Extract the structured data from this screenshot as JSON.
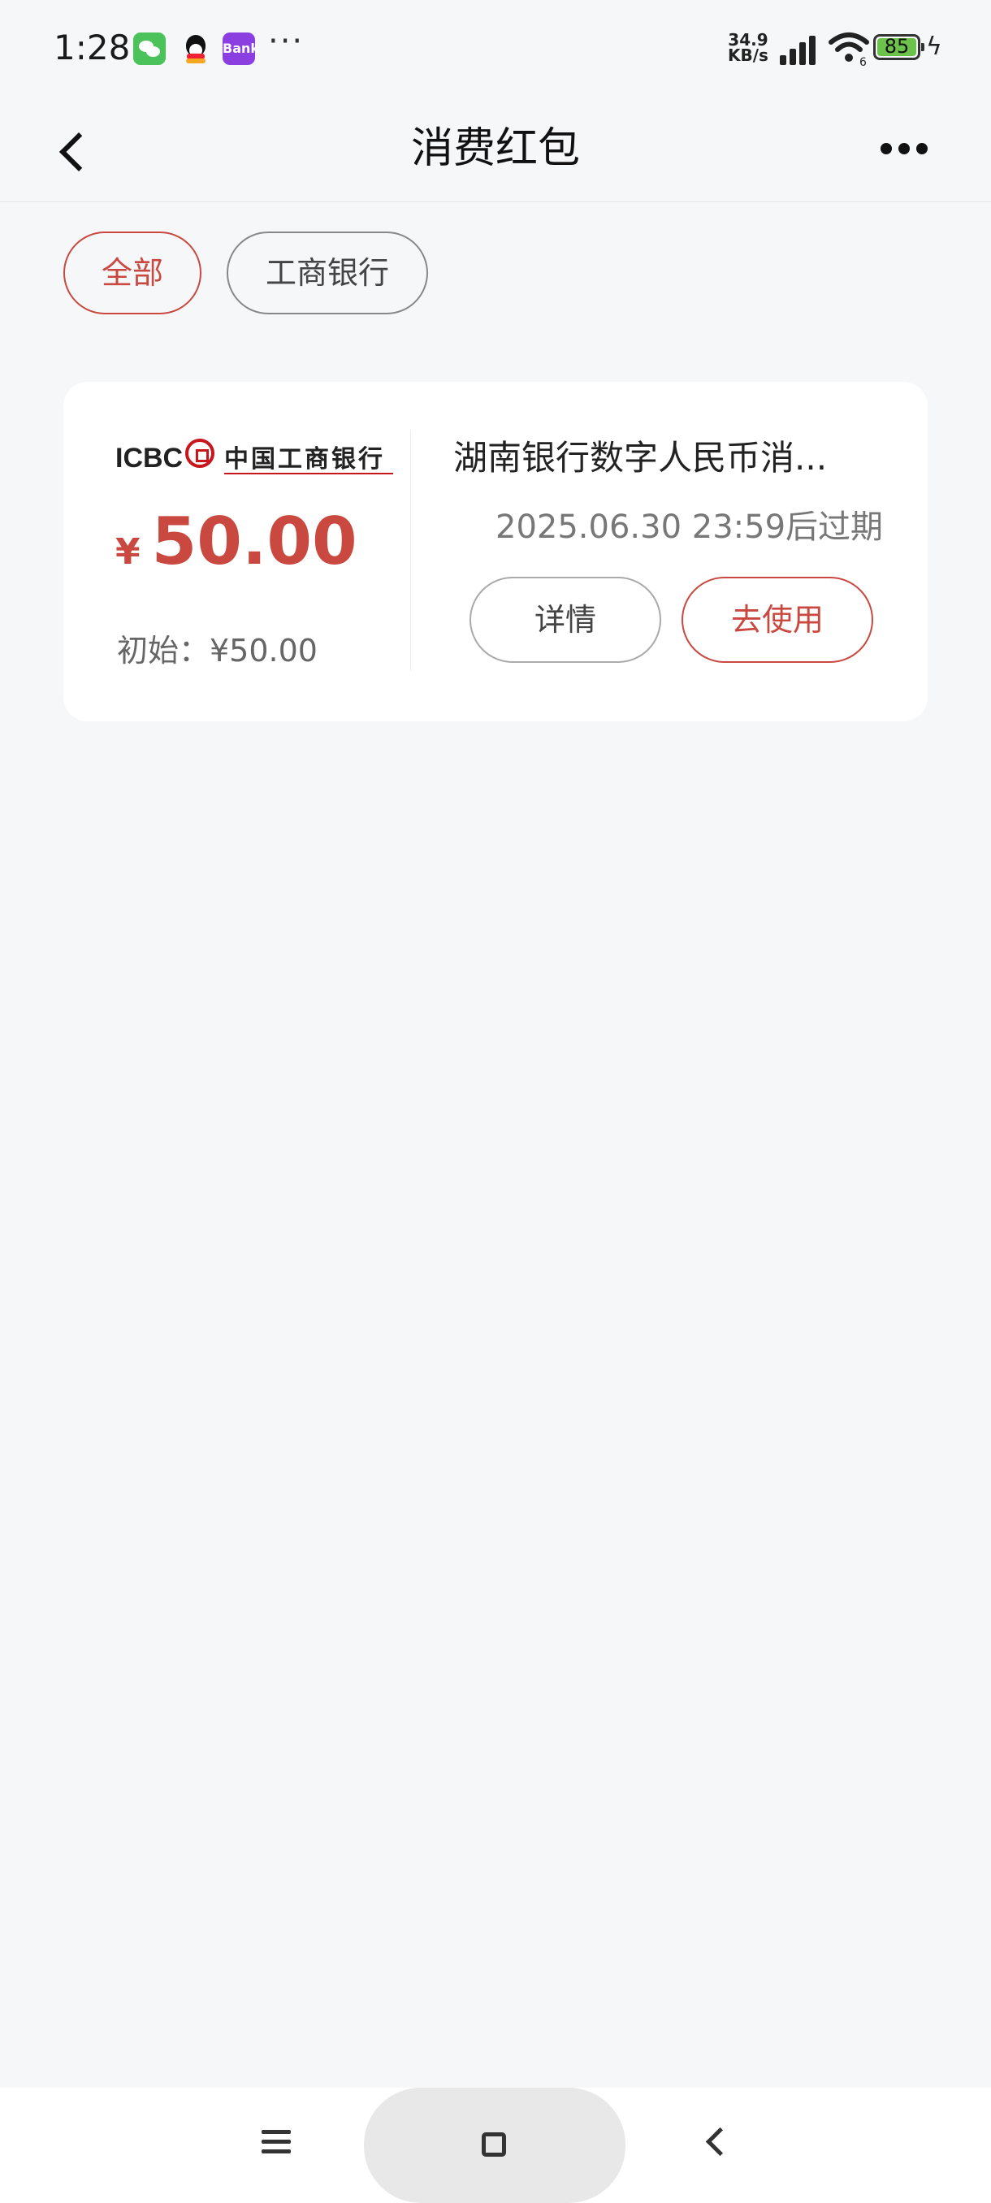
{
  "status_bar": {
    "time": "1:28",
    "more_notifications": "···",
    "net_speed_value": "34.9",
    "net_speed_unit": "KB/s",
    "battery_level": "85",
    "bank_app_label": "Bank"
  },
  "header": {
    "title": "消费红包"
  },
  "filters": [
    {
      "label": "全部",
      "selected": true
    },
    {
      "label": "工商银行",
      "selected": false
    }
  ],
  "coupon": {
    "bank_logo_en": "ICBC",
    "bank_logo_cn": "中国工商银行",
    "currency_symbol": "¥",
    "amount": "50.00",
    "initial_label": "初始：¥50.00",
    "name": "湖南银行数字人民币消...",
    "expiry": "2025.06.30 23:59后过期",
    "detail_button": "详情",
    "use_button": "去使用"
  },
  "colors": {
    "accent": "#c94940",
    "background": "#f6f7f9"
  },
  "nav_icons": [
    "menu-icon",
    "home-icon",
    "back-icon"
  ]
}
